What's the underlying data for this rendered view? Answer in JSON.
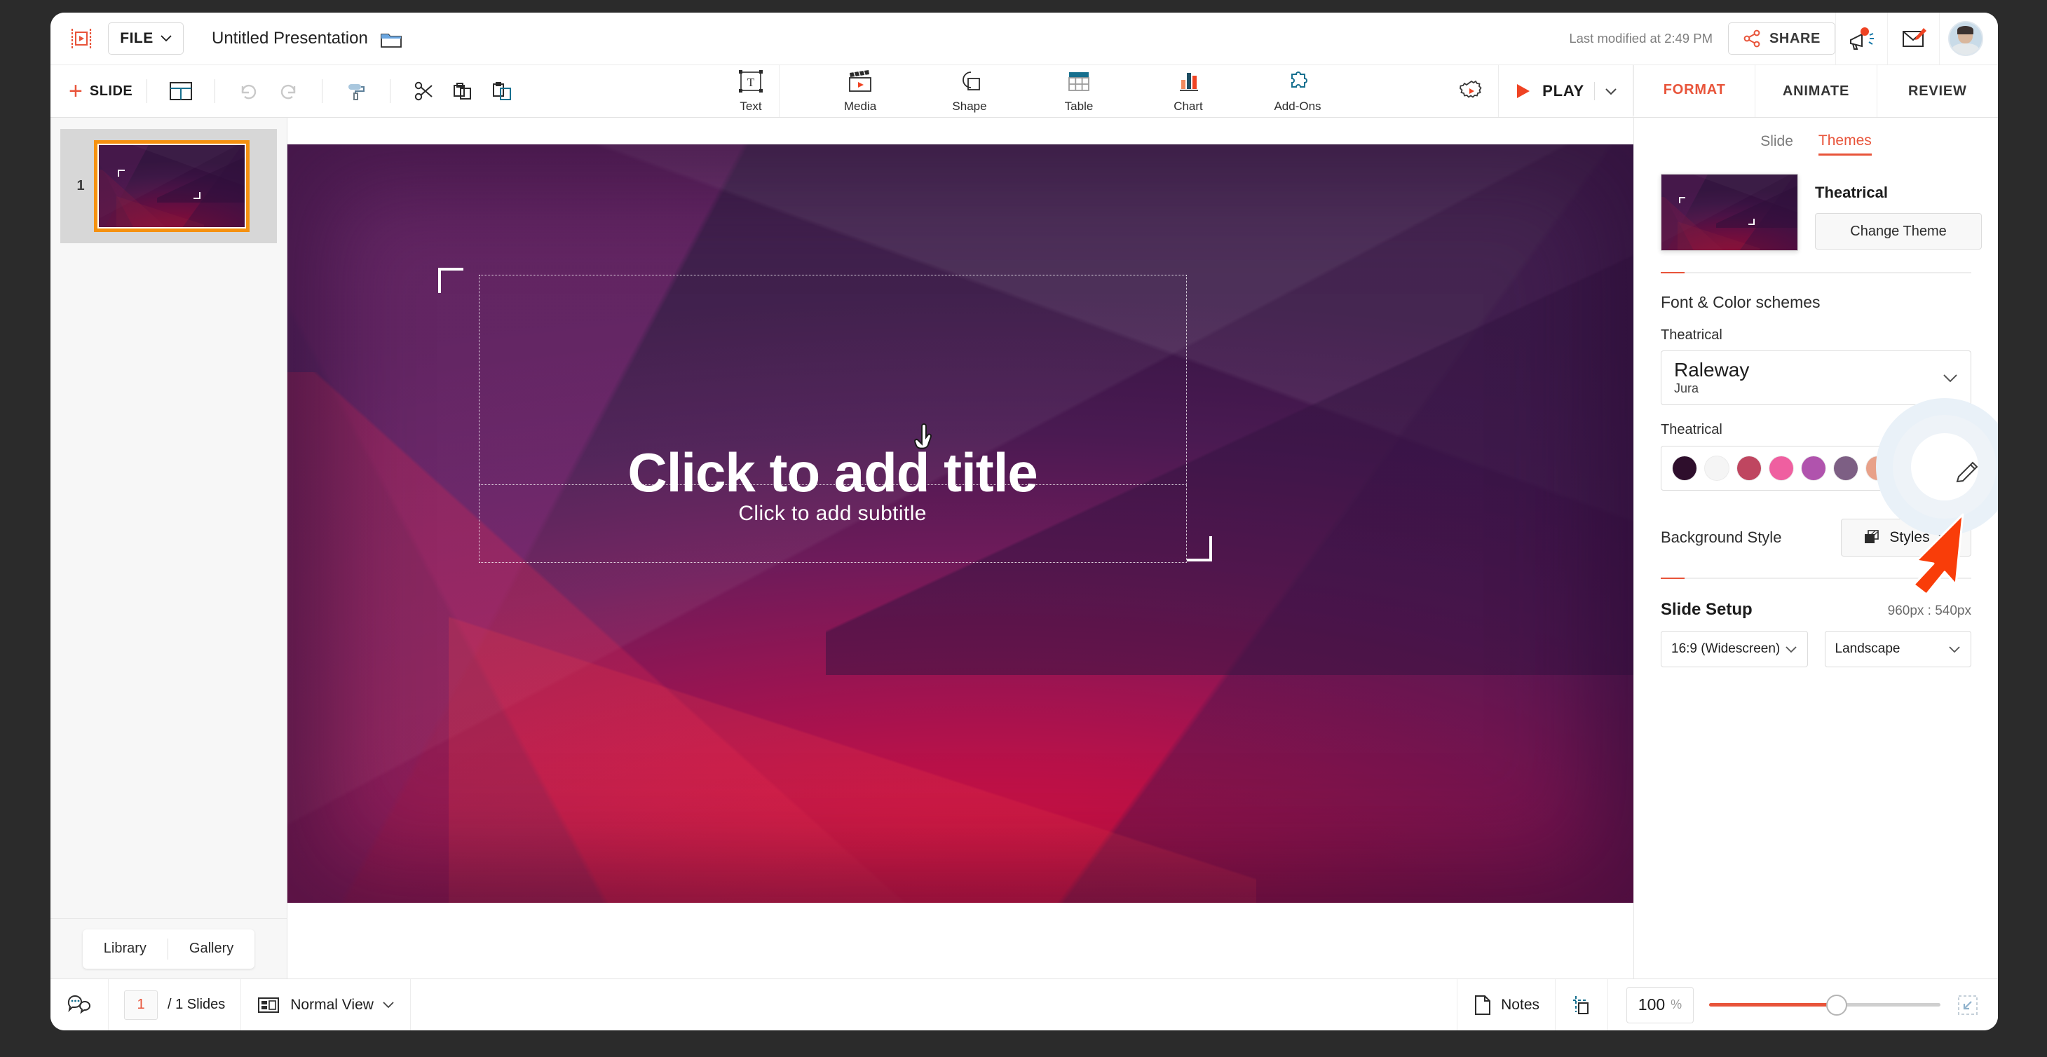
{
  "app": {
    "logo_icon": "presentation-logo-icon",
    "file_menu_label": "FILE",
    "document_title": "Untitled Presentation",
    "folder_icon": "folder-icon",
    "last_modified": "Last modified at 2:49 PM",
    "share_label": "SHARE",
    "share_icon": "share-nodes-icon",
    "announcement_icon": "megaphone-icon",
    "feedback_icon": "compose-mail-icon",
    "avatar_icon": "user-avatar"
  },
  "toolbar": {
    "add_slide_label": "SLIDE",
    "add_slide_plus": "+",
    "layout_icon": "slide-layout-icon",
    "undo_icon": "undo-icon",
    "redo_icon": "redo-icon",
    "format_painter_icon": "format-painter-icon",
    "cut_icon": "scissors-icon",
    "copy_icon": "copy-icon",
    "paste_icon": "paste-icon",
    "insert_items": [
      {
        "label": "Text",
        "icon": "text-box-icon"
      },
      {
        "label": "Media",
        "icon": "media-clapperboard-icon"
      },
      {
        "label": "Shape",
        "icon": "shape-icon"
      },
      {
        "label": "Table",
        "icon": "table-icon"
      },
      {
        "label": "Chart",
        "icon": "bar-chart-icon"
      },
      {
        "label": "Add-Ons",
        "icon": "puzzle-piece-icon"
      }
    ],
    "settings_icon": "gear-play-icon",
    "play_label": "PLAY",
    "play_icon": "play-triangle-icon",
    "play_dropdown_icon": "chevron-down-icon"
  },
  "format_tabs": [
    {
      "label": "FORMAT",
      "active": true
    },
    {
      "label": "ANIMATE",
      "active": false
    },
    {
      "label": "REVIEW",
      "active": false
    }
  ],
  "slide_panel": {
    "slides": [
      {
        "number": "1"
      }
    ],
    "library_label": "Library",
    "gallery_label": "Gallery"
  },
  "canvas": {
    "title_placeholder": "Click to add title",
    "subtitle_placeholder": "Click to add subtitle",
    "cursor_icon": "hand-pointer-cursor"
  },
  "right_panel": {
    "sub_tabs": [
      {
        "label": "Slide",
        "active": false
      },
      {
        "label": "Themes",
        "active": true
      }
    ],
    "theme_name": "Theatrical",
    "change_theme_label": "Change Theme",
    "font_color_heading": "Font & Color schemes",
    "font_scheme_label": "Theatrical",
    "font_primary": "Raleway",
    "font_secondary": "Jura",
    "font_edit_icon": "pencil-edit-icon",
    "font_dropdown_icon": "chevron-down-icon",
    "color_scheme_label": "Theatrical",
    "color_edit_icon": "pencil-edit-icon",
    "color_dropdown_icon": "chevron-down-icon",
    "colors": [
      "#2e0e2c",
      "#f5f5f5",
      "#bf4660",
      "#ef5fa0",
      "#b053ad",
      "#7d5f84",
      "#e8a189",
      "#8fcdd3"
    ],
    "background_style_label": "Background Style",
    "styles_label": "Styles",
    "styles_icon": "background-styles-icon",
    "styles_dropdown_icon": "chevron-down-icon",
    "slide_setup_label": "Slide Setup",
    "slide_dimensions": "960px : 540px",
    "aspect_ratio": "16:9 (Widescreen)",
    "orientation": "Landscape",
    "highlight_arrow_icon": "red-arrow-pointer"
  },
  "status_bar": {
    "comments_icon": "comment-bubbles-icon",
    "current_page": "1",
    "slides_count": "/ 1 Slides",
    "view_icon": "normal-view-icon",
    "view_label": "Normal View",
    "view_dropdown_icon": "chevron-down-icon",
    "notes_icon": "notes-page-icon",
    "notes_label": "Notes",
    "guides_icon": "guides-icon",
    "zoom_value": "100",
    "zoom_unit": "%",
    "fit_icon": "fit-to-screen-icon"
  },
  "colors": {
    "accent": "#e8543a",
    "selection": "#f59110",
    "teal": "#17708f"
  }
}
